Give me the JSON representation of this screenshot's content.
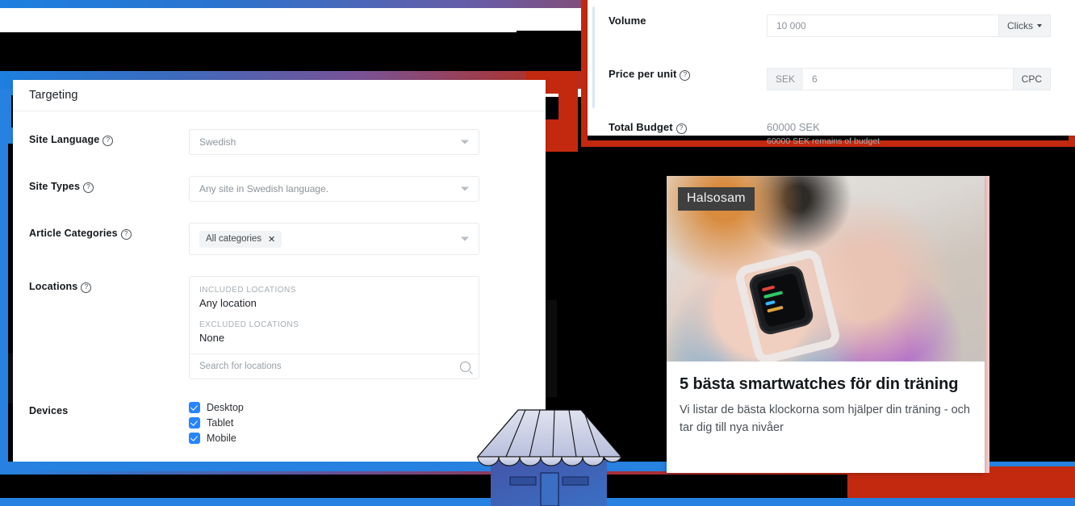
{
  "targeting": {
    "title": "Targeting",
    "rows": [
      {
        "label": "Site Language",
        "help": "?",
        "value": "Swedish",
        "type": "select"
      },
      {
        "label": "Site Types",
        "help": "?",
        "value": "Any site in Swedish language.",
        "type": "select"
      },
      {
        "label": "Article Categories",
        "help": "?",
        "value": "All categories",
        "chip_remove": "✕",
        "type": "chip-select"
      }
    ],
    "locations": {
      "label": "Locations",
      "help": "?",
      "included_caption": "INCLUDED LOCATIONS",
      "included_value": "Any location",
      "excluded_caption": "EXCLUDED LOCATIONS",
      "excluded_value": "None",
      "search_placeholder": "Search for locations",
      "search_icon": "search-icon"
    },
    "devices": {
      "label": "Devices",
      "items": [
        {
          "label": "Desktop",
          "checked": true
        },
        {
          "label": "Tablet",
          "checked": true
        },
        {
          "label": "Mobile",
          "checked": true
        }
      ]
    }
  },
  "budget": {
    "volume": {
      "label": "Volume",
      "value": "10 000",
      "unit": "Clicks",
      "unit_caret": "caret-down-icon"
    },
    "price": {
      "label": "Price per unit",
      "help": "?",
      "currency": "SEK",
      "value": "6",
      "suffix": "CPC"
    },
    "total": {
      "label": "Total Budget",
      "help": "?",
      "value": "60000 SEK",
      "note": "60000 SEK remains of budget"
    }
  },
  "ad_preview": {
    "badge": "Halsosam",
    "title": "5 bästa smartwatches för din träning",
    "description": "Vi listar de bästa klockorna som hjälper din träning - och tar dig till nya nivåer"
  },
  "colors": {
    "accent_blue": "#2681e0",
    "accent_red": "#c2290f",
    "checkbox_blue": "#2684ff",
    "panel_white": "#ffffff",
    "backdrop_black": "#000000",
    "badge_gray": "#3f3f3f",
    "pink_edge": "#f4cccb"
  }
}
